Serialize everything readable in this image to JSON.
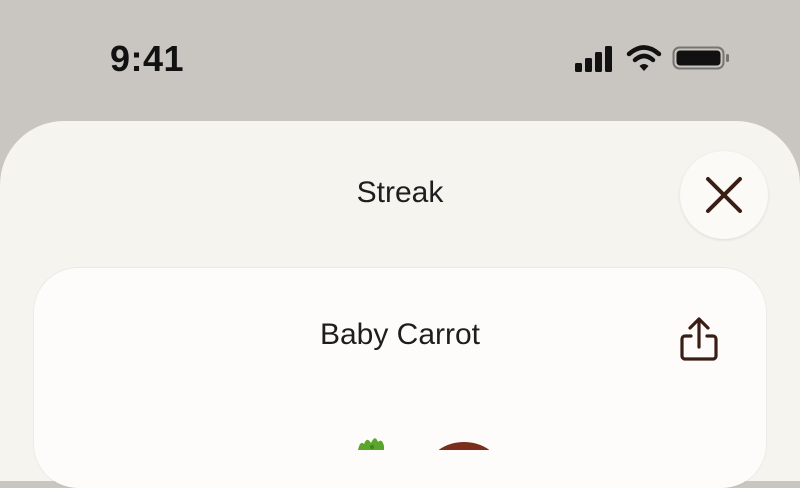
{
  "status_bar": {
    "time": "9:41",
    "icons": [
      "signal-icon",
      "wifi-icon",
      "battery-icon"
    ]
  },
  "sheet": {
    "title": "Streak",
    "close_icon": "close-icon",
    "card": {
      "title": "Baby Carrot",
      "share_icon": "share-icon",
      "illustration": "baby-carrot-icon"
    }
  },
  "colors": {
    "background": "#c9c5c0",
    "sheet": "#f6f4ef",
    "card": "#fdfcfa",
    "icon_brown": "#3a1e16",
    "carrot_leaf": "#5aa52b",
    "carrot_body": "#7a2e1c"
  }
}
